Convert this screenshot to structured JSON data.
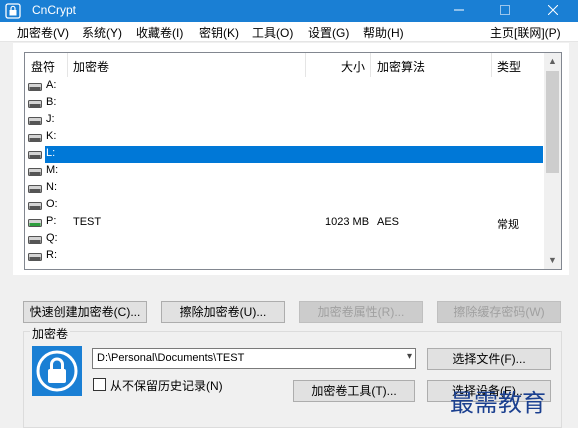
{
  "window": {
    "title": "CnCrypt",
    "accent": "#1a7fd4"
  },
  "menu": {
    "items": [
      "加密卷(V)",
      "系统(Y)",
      "收藏卷(I)",
      "密钥(K)",
      "工具(O)",
      "设置(G)",
      "帮助(H)"
    ],
    "homepage": "主页[联网](P)"
  },
  "table": {
    "columns": [
      "盘符",
      "加密卷",
      "大小",
      "加密算法",
      "类型"
    ],
    "rows": [
      {
        "drive": "A:",
        "volume": "",
        "size": "",
        "algorithm": "",
        "type": ""
      },
      {
        "drive": "B:",
        "volume": "",
        "size": "",
        "algorithm": "",
        "type": ""
      },
      {
        "drive": "J:",
        "volume": "",
        "size": "",
        "algorithm": "",
        "type": ""
      },
      {
        "drive": "K:",
        "volume": "",
        "size": "",
        "algorithm": "",
        "type": ""
      },
      {
        "drive": "L:",
        "volume": "",
        "size": "",
        "algorithm": "",
        "type": "",
        "selected": true
      },
      {
        "drive": "M:",
        "volume": "",
        "size": "",
        "algorithm": "",
        "type": ""
      },
      {
        "drive": "N:",
        "volume": "",
        "size": "",
        "algorithm": "",
        "type": ""
      },
      {
        "drive": "O:",
        "volume": "",
        "size": "",
        "algorithm": "",
        "type": ""
      },
      {
        "drive": "P:",
        "volume": "TEST",
        "size": "1023 MB",
        "algorithm": "AES",
        "type": "常规",
        "mounted": true
      },
      {
        "drive": "Q:",
        "volume": "",
        "size": "",
        "algorithm": "",
        "type": ""
      },
      {
        "drive": "R:",
        "volume": "",
        "size": "",
        "algorithm": "",
        "type": ""
      }
    ]
  },
  "buttons": {
    "quick_create": "快速创建加密卷(C)...",
    "erase": "擦除加密卷(U)...",
    "properties": "加密卷属性(R)...",
    "wipe_cache": "擦除缓存密码(W)",
    "select_file": "选择文件(F)...",
    "volume_tools": "加密卷工具(T)...",
    "select_device": "选择设备(E)..."
  },
  "volume_group": {
    "label": "加密卷",
    "path": "D:\\Personal\\Documents\\TEST",
    "no_history_label": "从不保留历史记录(N)"
  },
  "watermark": "最需教育"
}
